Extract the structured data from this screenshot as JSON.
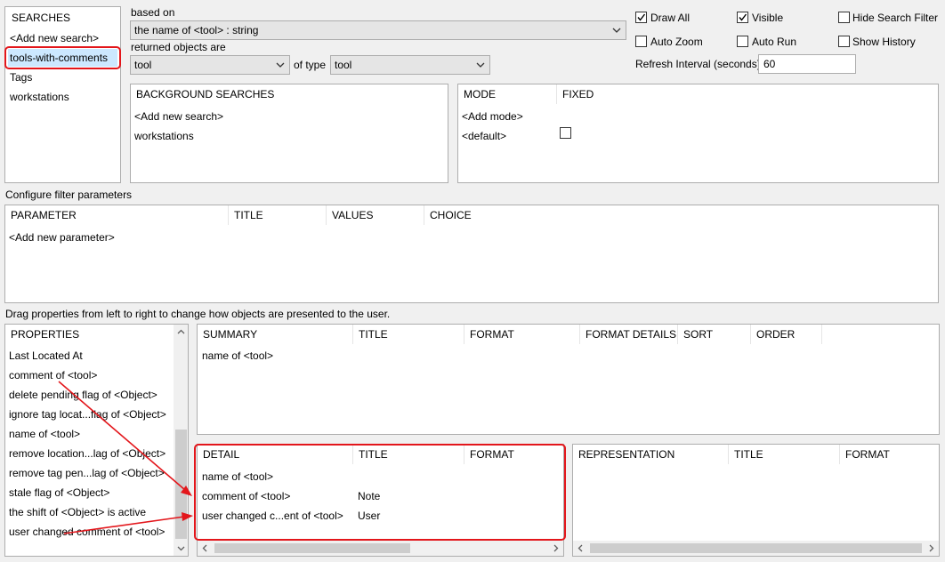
{
  "searches": {
    "header": "SEARCHES",
    "items": [
      "<Add new search>",
      "tools-with-comments",
      "Tags",
      "workstations"
    ]
  },
  "based_on": {
    "label": "based on",
    "value": "the name of <tool> : string"
  },
  "returned": {
    "label": "returned objects are",
    "value": "tool",
    "of_type_label": "of type",
    "type_value": "tool"
  },
  "options": {
    "draw_all": {
      "label": "Draw All",
      "checked": true
    },
    "visible": {
      "label": "Visible",
      "checked": true
    },
    "hide_search_filter": {
      "label": "Hide Search Filter",
      "checked": false
    },
    "auto_zoom": {
      "label": "Auto Zoom",
      "checked": false
    },
    "auto_run": {
      "label": "Auto Run",
      "checked": false
    },
    "show_history": {
      "label": "Show History",
      "checked": false
    },
    "refresh_label": "Refresh Interval (seconds)",
    "refresh_value": "60"
  },
  "background_searches": {
    "header": "BACKGROUND SEARCHES",
    "items": [
      "<Add new search>",
      "workstations"
    ]
  },
  "modes": {
    "headers": [
      "MODE",
      "FIXED"
    ],
    "items": [
      "<Add mode>",
      "<default>"
    ]
  },
  "filter": {
    "title": "Configure filter parameters",
    "headers": [
      "PARAMETER",
      "TITLE",
      "VALUES",
      "CHOICE"
    ],
    "items": [
      "<Add new parameter>"
    ]
  },
  "drag_hint": "Drag properties from left to right to change how objects are presented to the user.",
  "properties": {
    "header": "PROPERTIES",
    "items": [
      "Last Located At",
      "comment of <tool>",
      "delete pending flag of <Object>",
      "ignore tag locat...flag of <Object>",
      "name of <tool>",
      "remove location...lag of <Object>",
      "remove tag pen...lag of <Object>",
      "stale flag of <Object>",
      "the shift of <Object> is active",
      "user changed comment of <tool>"
    ]
  },
  "summary": {
    "headers": [
      "SUMMARY",
      "TITLE",
      "FORMAT",
      "FORMAT DETAILS",
      "SORT",
      "ORDER"
    ],
    "rows": [
      [
        "name of <tool>"
      ]
    ]
  },
  "detail": {
    "headers": [
      "DETAIL",
      "TITLE",
      "FORMAT"
    ],
    "rows": [
      [
        "name of <tool>",
        ""
      ],
      [
        "comment of <tool>",
        "Note"
      ],
      [
        "user changed c...ent of <tool>",
        "User"
      ]
    ]
  },
  "representation": {
    "headers": [
      "REPRESENTATION",
      "TITLE",
      "FORMAT"
    ]
  },
  "colors": {
    "annotation_red": "#e3161b",
    "selection_blue": "#cce8ff"
  }
}
